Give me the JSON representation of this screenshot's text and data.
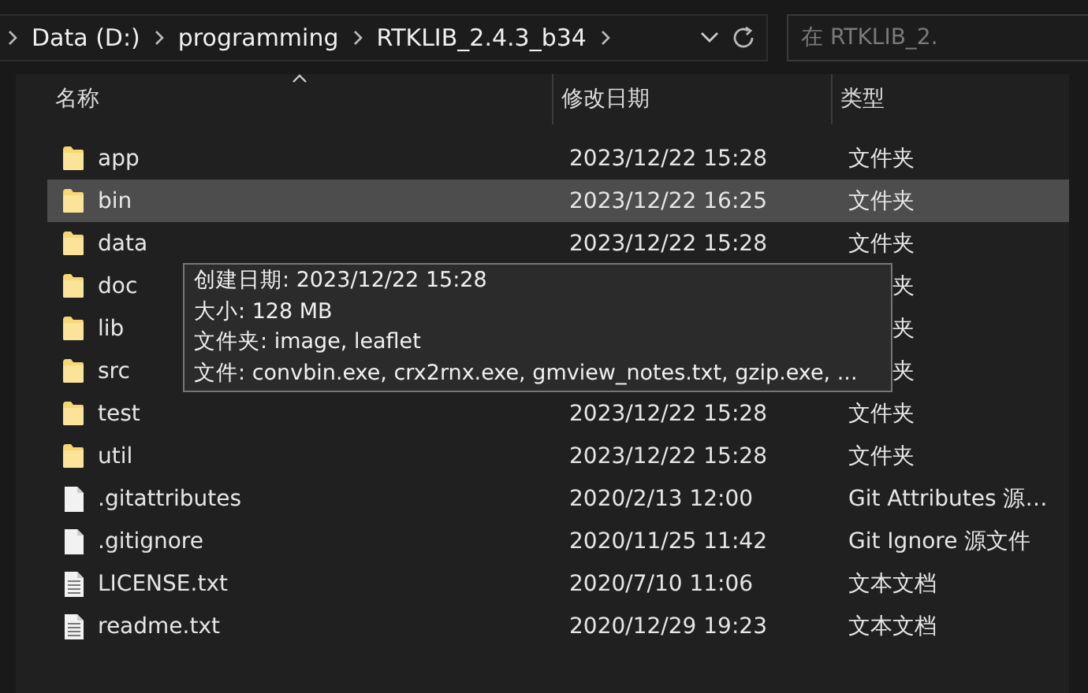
{
  "address_bar": {
    "path": [
      "Data (D:)",
      "programming",
      "RTKLIB_2.4.3_b34"
    ]
  },
  "search": {
    "placeholder": "在 RTKLIB_2."
  },
  "table": {
    "columns": [
      {
        "label": "名称",
        "sorted": true
      },
      {
        "label": "修改日期",
        "sorted": false
      },
      {
        "label": "类型",
        "sorted": false
      }
    ],
    "rows": [
      {
        "kind": "folder",
        "name": "app",
        "date": "2023/12/22 15:28",
        "type": "文件夹",
        "selected": false
      },
      {
        "kind": "folder",
        "name": "bin",
        "date": "2023/12/22 16:25",
        "type": "文件夹",
        "selected": true
      },
      {
        "kind": "folder",
        "name": "data",
        "date": "2023/12/22 15:28",
        "type": "文件夹",
        "selected": false
      },
      {
        "kind": "folder",
        "name": "doc",
        "type_tail": "夹",
        "selected": false
      },
      {
        "kind": "folder",
        "name": "lib",
        "type_tail": "夹",
        "selected": false
      },
      {
        "kind": "folder",
        "name": "src",
        "type_tail": "夹",
        "selected": false
      },
      {
        "kind": "folder",
        "name": "test",
        "date": "2023/12/22 15:28",
        "type": "文件夹",
        "selected": false
      },
      {
        "kind": "folder",
        "name": "util",
        "date": "2023/12/22 15:28",
        "type": "文件夹",
        "selected": false
      },
      {
        "kind": "file",
        "name": ".gitattributes",
        "date": "2020/2/13 12:00",
        "type": "Git Attributes 源…",
        "selected": false
      },
      {
        "kind": "file",
        "name": ".gitignore",
        "date": "2020/11/25 11:42",
        "type": "Git Ignore 源文件",
        "selected": false
      },
      {
        "kind": "text",
        "name": "LICENSE.txt",
        "date": "2020/7/10 11:06",
        "type": "文本文档",
        "selected": false
      },
      {
        "kind": "text",
        "name": "readme.txt",
        "date": "2020/12/29 19:23",
        "type": "文本文档",
        "selected": false
      }
    ]
  },
  "tooltip": {
    "lines": [
      "创建日期: 2023/12/22 15:28",
      "大小: 128 MB",
      "文件夹: image, leaflet",
      "文件: convbin.exe, crx2rnx.exe, gmview_notes.txt, gzip.exe, ..."
    ]
  }
}
